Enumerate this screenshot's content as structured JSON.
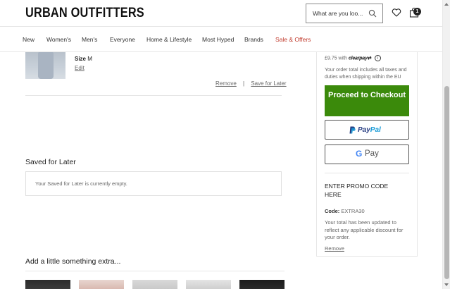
{
  "header": {
    "logo": "URBAN OUTFITTERS",
    "search_placeholder": "What are you loo...",
    "bag_count": "1"
  },
  "nav": {
    "items": [
      "New",
      "Women's",
      "Men's",
      "Everyone",
      "Home & Lifestyle",
      "Most Hyped",
      "Brands",
      "Sale & Offers"
    ]
  },
  "cart_item": {
    "size_label": "Size",
    "size_value": "M",
    "edit_label": "Edit",
    "remove_label": "Remove",
    "separator": "|",
    "save_later_label": "Save for Later"
  },
  "saved_for_later": {
    "title": "Saved for Later",
    "empty_message": "Your Saved for Later is currently empty."
  },
  "extras": {
    "title": "Add a little something extra..."
  },
  "summary": {
    "clearpay_prefix": "£9.75 with",
    "clearpay_brand": "clearpay",
    "info_glyph": "i",
    "tax_note": "Your order total includes all taxes and duties when shipping within the EU",
    "checkout_label": "Proceed to Checkout",
    "paypal_label_a": "Pay",
    "paypal_label_b": "Pal",
    "gpay_g": "G",
    "gpay_label": "Pay"
  },
  "promo": {
    "title": "ENTER PROMO CODE HERE",
    "code_label": "Code:",
    "code_value": "EXTRA30",
    "note": "Your total has been updated to reflect any applicable discount for your order.",
    "remove_label": "Remove"
  },
  "colors": {
    "checkout_green": "#3b8a0b",
    "sale_red": "#c0392b",
    "paypal_blue": "#253b80",
    "paypal_light": "#179bd7"
  }
}
